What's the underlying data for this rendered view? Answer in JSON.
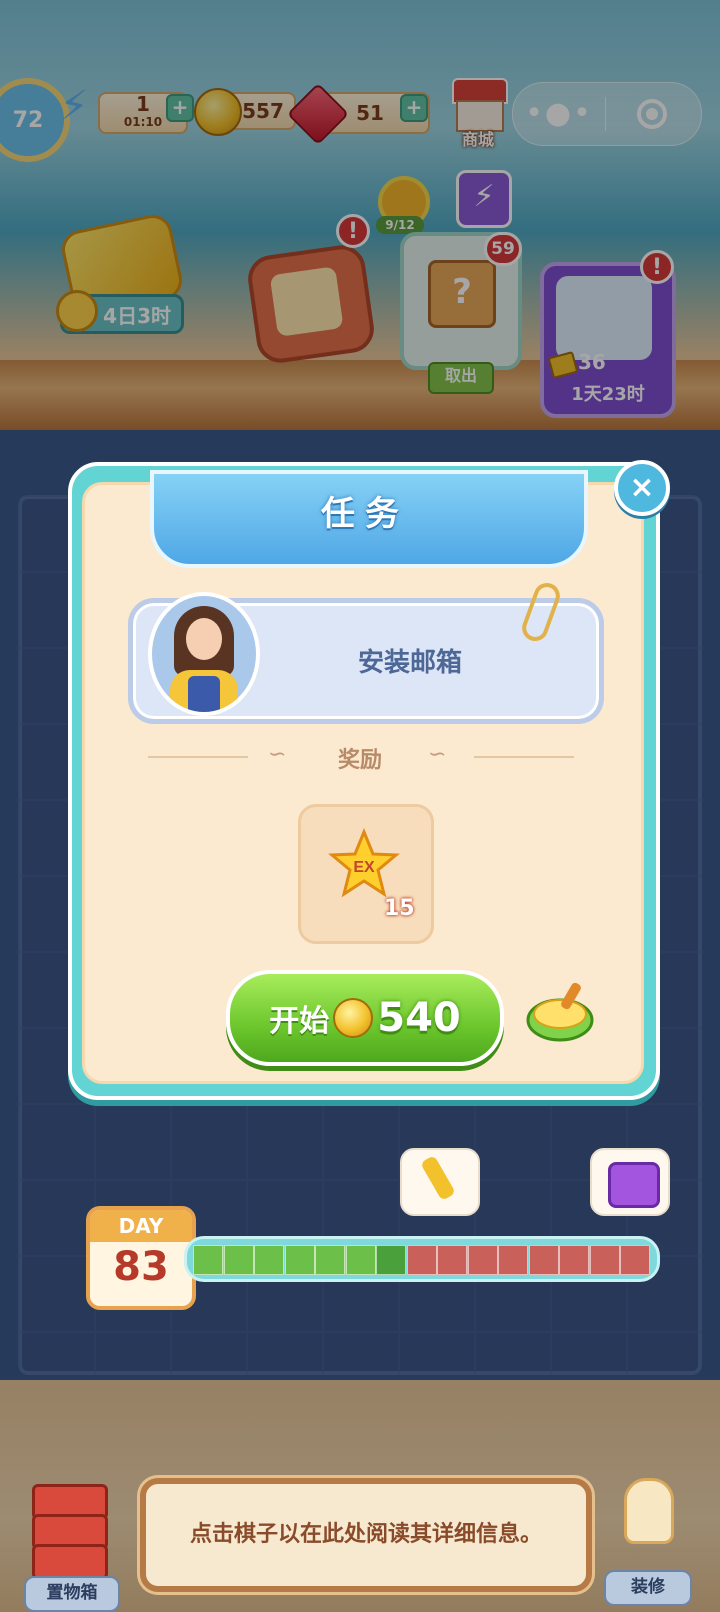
{
  "hud": {
    "level": "72",
    "energy_count": "1",
    "energy_timer": "01:10",
    "coins": "557",
    "gems": "51",
    "shop_label": "商城",
    "plus_symbol": "+"
  },
  "events": {
    "honey_timer": "4日3时",
    "flower_progress": "9/12",
    "crate_count": "59",
    "takeout_label": "取出",
    "event_tickets": "36",
    "event_timer": "1天23时",
    "alert_symbol": "!"
  },
  "modal": {
    "title": "任务",
    "task_name": "安装邮箱",
    "reward_label": "奖励",
    "reward_icon_text": "EX",
    "reward_amount": "15",
    "start_label": "开始",
    "start_cost": "540",
    "close_symbol": "×"
  },
  "progress": {
    "day_label": "DAY",
    "day_number": "83",
    "filled_segments": 7,
    "total_segments": 15,
    "colors": {
      "filled": "#6cc04a",
      "current": "#4aa03a",
      "empty": "#c9605a"
    }
  },
  "bottom": {
    "info_text": "点击棋子以在此处阅读其详细信息。",
    "storage_label": "置物箱",
    "decorate_label": "装修"
  },
  "icons": [
    "level-ring",
    "bolt-icon",
    "coin-icon",
    "gem-icon",
    "shop-icon",
    "more-icon",
    "exit-target-icon",
    "close-icon",
    "paperclip-icon",
    "star-icon",
    "pot-icon",
    "key-icon",
    "chest-icon"
  ],
  "colors": {
    "modal_frame": "#62d4d3",
    "modal_body": "#fbead0",
    "start_button": "#6cc62c",
    "title_bar": "#4fa7e6"
  }
}
